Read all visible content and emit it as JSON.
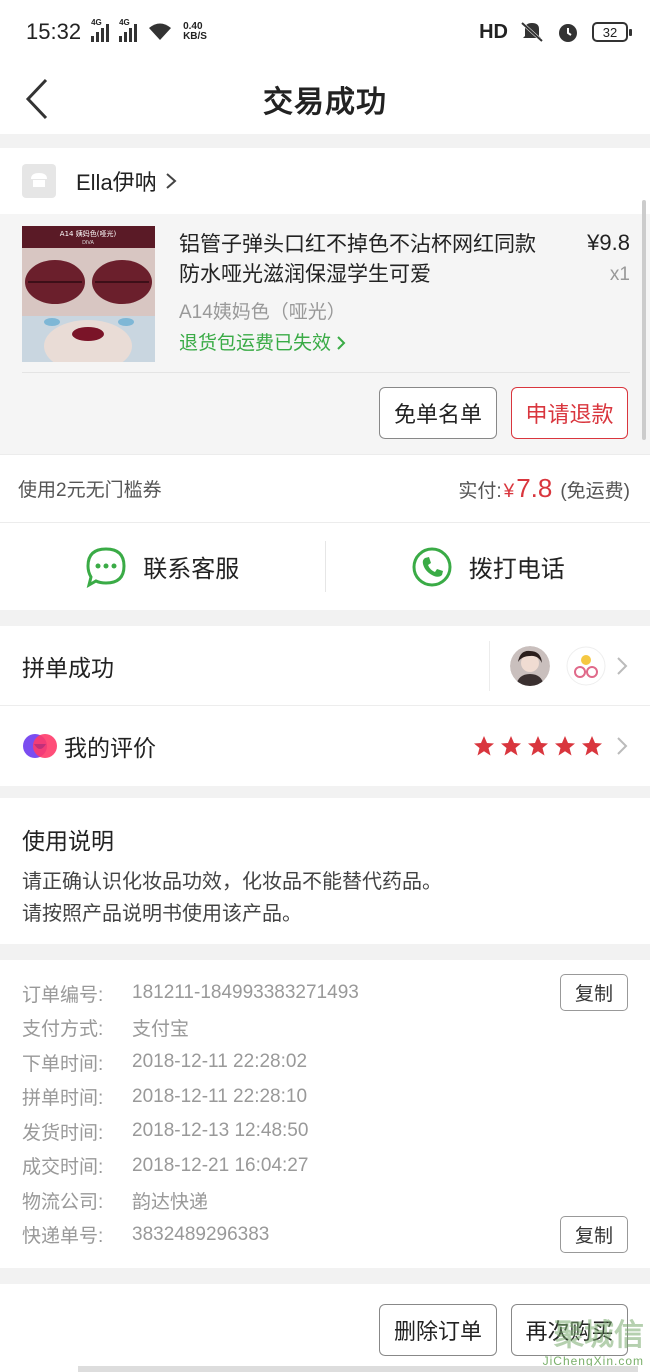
{
  "status_bar": {
    "time": "15:32",
    "network1": "4G",
    "network2": "4G",
    "speed_value": "0.40",
    "speed_unit": "KB/S",
    "hd": "HD",
    "battery": "32"
  },
  "nav": {
    "title": "交易成功"
  },
  "shop": {
    "name": "Ella伊呐"
  },
  "product": {
    "title": "铝管子弹头口红不掉色不沾杯网红同款防水哑光滋润保湿学生可爱",
    "price": "¥9.8",
    "qty": "x1",
    "sku": "A14姨妈色（哑光）",
    "return_note": "退货包运费已失效",
    "thumb_caption": "A14 姨妈色(哑光)",
    "thumb_sub": "DIVA",
    "buttons": {
      "free_list": "免单名单",
      "refund": "申请退款"
    }
  },
  "payment": {
    "coupon": "使用2元无门槛券",
    "paid_label": "实付:",
    "currency": "¥",
    "amount": "7.8",
    "shipping": "(免运费)"
  },
  "contact": {
    "service": "联系客服",
    "phone": "拨打电话"
  },
  "group": {
    "label": "拼单成功"
  },
  "review": {
    "label": "我的评价",
    "rating": 5
  },
  "notes": {
    "title": "使用说明",
    "lines": [
      "请正确认识化妆品功效，化妆品不能替代药品。",
      "请按照产品说明书使用该产品。"
    ]
  },
  "order_info": {
    "copy_label": "复制",
    "rows": [
      {
        "label": "订单编号:",
        "value": "181211-184993383271493"
      },
      {
        "label": "支付方式:",
        "value": "支付宝"
      },
      {
        "label": "下单时间:",
        "value": "2018-12-11 22:28:02"
      },
      {
        "label": "拼单时间:",
        "value": "2018-12-11 22:28:10"
      },
      {
        "label": "发货时间:",
        "value": "2018-12-13 12:48:50"
      },
      {
        "label": "成交时间:",
        "value": "2018-12-21 16:04:27"
      },
      {
        "label": "物流公司:",
        "value": "韵达快递"
      },
      {
        "label": "快递单号:",
        "value": "3832489296383"
      }
    ]
  },
  "bottom": {
    "delete": "删除订单",
    "rebuy": "再次购买"
  },
  "watermark": {
    "brand": "聚城信",
    "domain": "JiChengXin.com"
  },
  "colors": {
    "accent_red": "#d9363e",
    "green": "#3aab46"
  }
}
